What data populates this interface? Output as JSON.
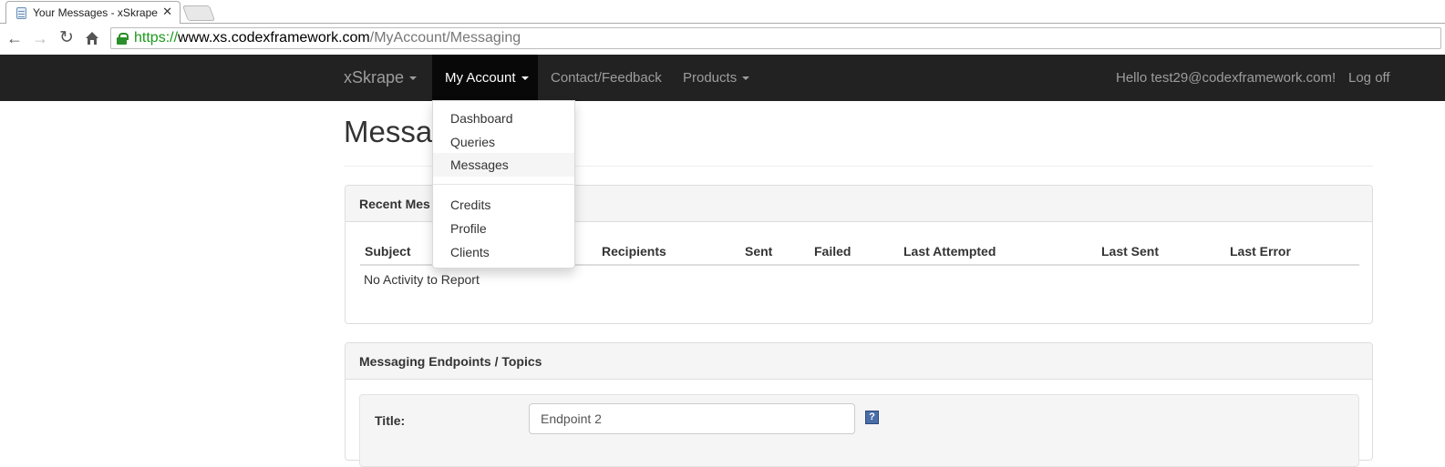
{
  "browser": {
    "tab_title": "Your Messages - xSkrape",
    "tab_close": "✕",
    "url_scheme": "https://",
    "url_host": "www.xs.codexframework.com",
    "url_path": "/MyAccount/Messaging"
  },
  "navbar": {
    "brand": "xSkrape",
    "my_account": "My Account",
    "contact": "Contact/Feedback",
    "products": "Products",
    "hello": "Hello test29@codexframework.com!",
    "logoff": "Log off"
  },
  "dropdown": {
    "group1": [
      "Dashboard",
      "Queries",
      "Messages"
    ],
    "group2": [
      "Credits",
      "Profile",
      "Clients"
    ],
    "active": "Messages"
  },
  "page": {
    "title": "Messag"
  },
  "recent_panel": {
    "heading": "Recent Mes",
    "columns": [
      "Subject",
      "Recipients",
      "Sent",
      "Failed",
      "Last Attempted",
      "Last Sent",
      "Last Error"
    ],
    "empty": "No Activity to Report"
  },
  "endpoints_panel": {
    "heading": "Messaging Endpoints / Topics",
    "title_label": "Title:",
    "title_value": "Endpoint 2",
    "help": "?"
  }
}
